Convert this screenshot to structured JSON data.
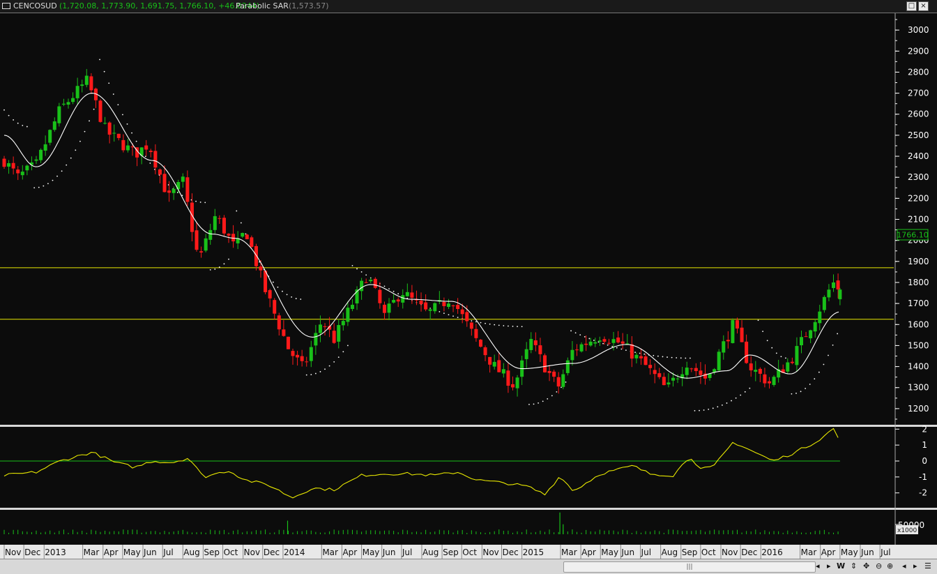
{
  "title_bar": {
    "symbol": "CENCOSUD",
    "ohlc": "(1,720.08, 1,773.90, 1,691.75, 1,766.10, +46.0244)",
    "indicator": "Parabolic SAR",
    "indicator_value": "(1,573.57)"
  },
  "colors": {
    "background": "#0c0c0c",
    "up_candle": "#19c019",
    "down_candle": "#ff1a1a",
    "sar": "#ffffff",
    "moving_average": "#ffffff",
    "horizontal_line": "#e8e800",
    "oscillator": "#e8e800",
    "zero_line": "#19c019",
    "volume": "#19c019",
    "ohlc_text": "#19c019"
  },
  "chart_data": [
    {
      "type": "candlestick",
      "ylim": [
        1130,
        3080
      ],
      "yticks": [
        1200,
        1300,
        1400,
        1500,
        1600,
        1700,
        1800,
        1900,
        2000,
        2100,
        2200,
        2300,
        2400,
        2500,
        2600,
        2700,
        2800,
        2900,
        3000
      ],
      "last_price_label": "1766.10",
      "last_price": 1766.1,
      "horizontal_lines": [
        1870,
        1625
      ],
      "ma_control_points": [
        {
          "date": "2012-11-01",
          "value": 2500
        },
        {
          "date": "2012-12-20",
          "value": 2350
        },
        {
          "date": "2013-03-15",
          "value": 2700
        },
        {
          "date": "2013-06-15",
          "value": 2380
        },
        {
          "date": "2013-09-15",
          "value": 2030
        },
        {
          "date": "2013-10-20",
          "value": 2010
        },
        {
          "date": "2014-02-15",
          "value": 1540
        },
        {
          "date": "2014-05-15",
          "value": 1790
        },
        {
          "date": "2014-07-15",
          "value": 1720
        },
        {
          "date": "2014-09-15",
          "value": 1710
        },
        {
          "date": "2015-01-01",
          "value": 1390
        },
        {
          "date": "2015-03-20",
          "value": 1415
        },
        {
          "date": "2015-06-10",
          "value": 1505
        },
        {
          "date": "2015-09-10",
          "value": 1345
        },
        {
          "date": "2015-11-10",
          "value": 1380
        },
        {
          "date": "2015-12-15",
          "value": 1455
        },
        {
          "date": "2016-02-15",
          "value": 1365
        },
        {
          "date": "2016-05-01",
          "value": 1660
        }
      ],
      "sar_segments": [
        {
          "side": "above",
          "from": "2012-11-01",
          "to": "2012-12-10",
          "start": 2620,
          "end": 2540
        },
        {
          "side": "below",
          "from": "2012-12-17",
          "to": "2013-03-20",
          "start": 2250,
          "end": 2640
        },
        {
          "side": "above",
          "from": "2013-03-27",
          "to": "2013-09-05",
          "start": 2860,
          "end": 2180
        },
        {
          "side": "below",
          "from": "2013-09-12",
          "to": "2013-10-15",
          "start": 1860,
          "end": 1930
        },
        {
          "side": "above",
          "from": "2013-10-22",
          "to": "2014-01-30",
          "start": 2140,
          "end": 1720
        },
        {
          "side": "below",
          "from": "2014-02-06",
          "to": "2014-04-10",
          "start": 1360,
          "end": 1500
        },
        {
          "side": "above",
          "from": "2014-04-17",
          "to": "2015-01-05",
          "start": 1880,
          "end": 1590
        },
        {
          "side": "below",
          "from": "2015-01-12",
          "to": "2015-03-10",
          "start": 1220,
          "end": 1330
        },
        {
          "side": "above",
          "from": "2015-03-17",
          "to": "2015-09-15",
          "start": 1570,
          "end": 1440
        },
        {
          "side": "below",
          "from": "2015-09-22",
          "to": "2015-12-20",
          "start": 1190,
          "end": 1310
        },
        {
          "side": "above",
          "from": "2015-12-28",
          "to": "2016-02-10",
          "start": 1620,
          "end": 1440
        },
        {
          "side": "below",
          "from": "2016-02-17",
          "to": "2016-05-01",
          "start": 1270,
          "end": 1590
        }
      ],
      "anchors": [
        {
          "date": "2012-11-01",
          "value": 2380
        },
        {
          "date": "2012-11-22",
          "value": 2300
        },
        {
          "date": "2012-12-20",
          "value": 2360
        },
        {
          "date": "2013-01-25",
          "value": 2620
        },
        {
          "date": "2013-03-08",
          "value": 2760
        },
        {
          "date": "2013-04-05",
          "value": 2520
        },
        {
          "date": "2013-05-20",
          "value": 2410
        },
        {
          "date": "2013-06-10",
          "value": 2460
        },
        {
          "date": "2013-07-10",
          "value": 2200
        },
        {
          "date": "2013-08-01",
          "value": 2280
        },
        {
          "date": "2013-08-25",
          "value": 1900
        },
        {
          "date": "2013-09-20",
          "value": 2120
        },
        {
          "date": "2013-10-20",
          "value": 1960
        },
        {
          "date": "2013-11-05",
          "value": 2050
        },
        {
          "date": "2013-12-05",
          "value": 1760
        },
        {
          "date": "2014-01-10",
          "value": 1480
        },
        {
          "date": "2014-02-01",
          "value": 1390
        },
        {
          "date": "2014-03-01",
          "value": 1620
        },
        {
          "date": "2014-03-20",
          "value": 1530
        },
        {
          "date": "2014-05-10",
          "value": 1840
        },
        {
          "date": "2014-06-05",
          "value": 1640
        },
        {
          "date": "2014-07-01",
          "value": 1760
        },
        {
          "date": "2014-08-10",
          "value": 1650
        },
        {
          "date": "2014-09-15",
          "value": 1730
        },
        {
          "date": "2014-10-20",
          "value": 1540
        },
        {
          "date": "2014-11-20",
          "value": 1400
        },
        {
          "date": "2014-12-20",
          "value": 1310
        },
        {
          "date": "2015-01-15",
          "value": 1520
        },
        {
          "date": "2015-02-05",
          "value": 1400
        },
        {
          "date": "2015-02-25",
          "value": 1300
        },
        {
          "date": "2015-03-20",
          "value": 1480
        },
        {
          "date": "2015-05-01",
          "value": 1550
        },
        {
          "date": "2015-06-01",
          "value": 1510
        },
        {
          "date": "2015-07-10",
          "value": 1400
        },
        {
          "date": "2015-08-10",
          "value": 1290
        },
        {
          "date": "2015-09-10",
          "value": 1420
        },
        {
          "date": "2015-10-10",
          "value": 1340
        },
        {
          "date": "2015-11-20",
          "value": 1600
        },
        {
          "date": "2015-12-15",
          "value": 1400
        },
        {
          "date": "2016-01-15",
          "value": 1320
        },
        {
          "date": "2016-02-20",
          "value": 1450
        },
        {
          "date": "2016-03-25",
          "value": 1640
        },
        {
          "date": "2016-04-20",
          "value": 1800
        },
        {
          "date": "2016-05-01",
          "value": 1766
        }
      ]
    },
    {
      "type": "line",
      "ylim": [
        -2.8,
        2.1
      ],
      "yticks": [
        2,
        1,
        0,
        -1,
        -2
      ],
      "zero_line": 0,
      "anchors": [
        {
          "date": "2012-11-01",
          "value": -0.9
        },
        {
          "date": "2012-12-20",
          "value": -0.7
        },
        {
          "date": "2013-01-25",
          "value": 0
        },
        {
          "date": "2013-03-15",
          "value": 0.55
        },
        {
          "date": "2013-04-20",
          "value": -0.1
        },
        {
          "date": "2013-05-20",
          "value": -0.4
        },
        {
          "date": "2013-06-15",
          "value": 0
        },
        {
          "date": "2013-07-15",
          "value": -0.1
        },
        {
          "date": "2013-08-10",
          "value": 0.2
        },
        {
          "date": "2013-09-01",
          "value": -1
        },
        {
          "date": "2013-10-10",
          "value": -0.6
        },
        {
          "date": "2013-11-05",
          "value": -1.2
        },
        {
          "date": "2013-12-10",
          "value": -1.5
        },
        {
          "date": "2014-01-15",
          "value": -2.3
        },
        {
          "date": "2014-02-15",
          "value": -1.7
        },
        {
          "date": "2014-03-20",
          "value": -1.8
        },
        {
          "date": "2014-05-01",
          "value": -0.9
        },
        {
          "date": "2014-06-05",
          "value": -0.8
        },
        {
          "date": "2014-07-10",
          "value": -0.8
        },
        {
          "date": "2014-08-20",
          "value": -0.9
        },
        {
          "date": "2014-09-25",
          "value": -0.7
        },
        {
          "date": "2014-10-25",
          "value": -1.2
        },
        {
          "date": "2014-12-10",
          "value": -1.4
        },
        {
          "date": "2015-01-10",
          "value": -1.6
        },
        {
          "date": "2015-02-05",
          "value": -2.1
        },
        {
          "date": "2015-03-01",
          "value": -0.9
        },
        {
          "date": "2015-03-20",
          "value": -1.9
        },
        {
          "date": "2015-05-01",
          "value": -0.8
        },
        {
          "date": "2015-06-20",
          "value": -0.3
        },
        {
          "date": "2015-07-15",
          "value": -0.8
        },
        {
          "date": "2015-08-20",
          "value": -0.9
        },
        {
          "date": "2015-09-15",
          "value": 0.3
        },
        {
          "date": "2015-10-01",
          "value": -0.5
        },
        {
          "date": "2015-10-20",
          "value": -0.4
        },
        {
          "date": "2015-11-20",
          "value": 1.2
        },
        {
          "date": "2015-12-20",
          "value": 0.6
        },
        {
          "date": "2016-01-20",
          "value": 0
        },
        {
          "date": "2016-02-20",
          "value": 0.5
        },
        {
          "date": "2016-03-25",
          "value": 1.2
        },
        {
          "date": "2016-04-22",
          "value": 2.05
        },
        {
          "date": "2016-05-01",
          "value": 1.2
        }
      ]
    },
    {
      "type": "bar",
      "yticks_label": "50000",
      "unit_label": "x1000",
      "spikes": [
        {
          "date": "2014-01-08",
          "value": 3.0
        },
        {
          "date": "2015-02-28",
          "value": 4.8
        },
        {
          "date": "2015-03-05",
          "value": 2.2
        }
      ]
    }
  ],
  "x_axis": {
    "labels": [
      {
        "date": "2012-11-01",
        "text": "Nov"
      },
      {
        "date": "2012-12-01",
        "text": "Dec"
      },
      {
        "date": "2013-01-01",
        "text": "2013"
      },
      {
        "date": "2013-03-01",
        "text": "Mar"
      },
      {
        "date": "2013-04-01",
        "text": "Apr"
      },
      {
        "date": "2013-05-01",
        "text": "May"
      },
      {
        "date": "2013-06-01",
        "text": "Jun"
      },
      {
        "date": "2013-07-01",
        "text": "Jul"
      },
      {
        "date": "2013-08-01",
        "text": "Aug"
      },
      {
        "date": "2013-09-01",
        "text": "Sep"
      },
      {
        "date": "2013-10-01",
        "text": "Oct"
      },
      {
        "date": "2013-11-01",
        "text": "Nov"
      },
      {
        "date": "2013-12-01",
        "text": "Dec"
      },
      {
        "date": "2014-01-01",
        "text": "2014"
      },
      {
        "date": "2014-03-01",
        "text": "Mar"
      },
      {
        "date": "2014-04-01",
        "text": "Apr"
      },
      {
        "date": "2014-05-01",
        "text": "May"
      },
      {
        "date": "2014-06-01",
        "text": "Jun"
      },
      {
        "date": "2014-07-01",
        "text": "Jul"
      },
      {
        "date": "2014-08-01",
        "text": "Aug"
      },
      {
        "date": "2014-09-01",
        "text": "Sep"
      },
      {
        "date": "2014-10-01",
        "text": "Oct"
      },
      {
        "date": "2014-11-01",
        "text": "Nov"
      },
      {
        "date": "2014-12-01",
        "text": "Dec"
      },
      {
        "date": "2015-01-01",
        "text": "2015"
      },
      {
        "date": "2015-03-01",
        "text": "Mar"
      },
      {
        "date": "2015-04-01",
        "text": "Apr"
      },
      {
        "date": "2015-05-01",
        "text": "May"
      },
      {
        "date": "2015-06-01",
        "text": "Jun"
      },
      {
        "date": "2015-07-01",
        "text": "Jul"
      },
      {
        "date": "2015-08-01",
        "text": "Aug"
      },
      {
        "date": "2015-09-01",
        "text": "Sep"
      },
      {
        "date": "2015-10-01",
        "text": "Oct"
      },
      {
        "date": "2015-11-01",
        "text": "Nov"
      },
      {
        "date": "2015-12-01",
        "text": "Dec"
      },
      {
        "date": "2016-01-01",
        "text": "2016"
      },
      {
        "date": "2016-03-01",
        "text": "Mar"
      },
      {
        "date": "2016-04-01",
        "text": "Apr"
      },
      {
        "date": "2016-05-01",
        "text": "May"
      },
      {
        "date": "2016-06-01",
        "text": "Jun"
      },
      {
        "date": "2016-07-01",
        "text": "Jul"
      }
    ]
  },
  "scrollbar": {
    "grip": "|||",
    "icons": [
      "left-icon",
      "right-icon",
      "w-icon",
      "up-down-icon",
      "move-icon",
      "zoom-out-icon",
      "zoom-in-icon",
      "scroll-left-icon",
      "scroll-right-icon",
      "list-icon"
    ]
  }
}
